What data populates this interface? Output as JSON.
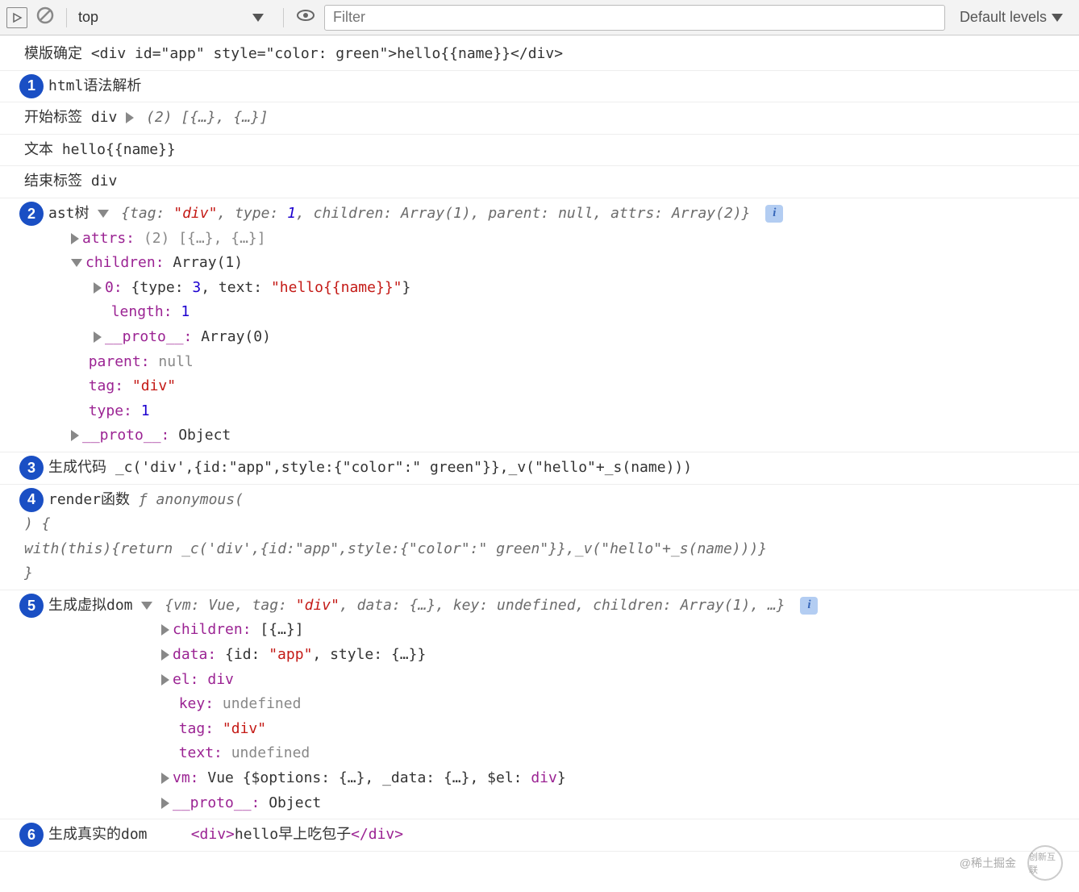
{
  "toolbar": {
    "context": "top",
    "filter_placeholder": "Filter",
    "levels": "Default levels"
  },
  "lines": {
    "l0_label": "模版确定",
    "l0_code": "<div id=\"app\" style=\"color: green\">hello{{name}}</div>",
    "b1": "1",
    "l1": "html语法解析",
    "l2_label": "开始标签 div",
    "l2_preview": "(2) [{…}, {…}]",
    "l3": "文本 hello{{name}}",
    "l4": "结束标签 div",
    "b2": "2",
    "l5_label": "ast树",
    "ast_summary_pre": "{tag: ",
    "ast_tag_val": "\"div\"",
    "ast_summary_mid1": ", type: ",
    "ast_type_val": "1",
    "ast_summary_mid2": ", children: Array(1), parent: null, attrs: Array(2)}",
    "ast_attrs_k": "attrs:",
    "ast_attrs_v": "(2) [{…}, {…}]",
    "ast_children_k": "children:",
    "ast_children_v": "Array(1)",
    "ast_c0_k": "0:",
    "ast_c0_pre": "{type: ",
    "ast_c0_type": "3",
    "ast_c0_mid": ", text: ",
    "ast_c0_text": "\"hello{{name}}\"",
    "ast_c0_post": "}",
    "ast_len_k": "length:",
    "ast_len_v": "1",
    "ast_cproto_k": "__proto__:",
    "ast_cproto_v": "Array(0)",
    "ast_parent_k": "parent:",
    "ast_parent_v": "null",
    "ast_tag_k": "tag:",
    "ast_tag_v2": "\"div\"",
    "ast_type_k": "type:",
    "ast_type_v2": "1",
    "ast_proto_k": "__proto__:",
    "ast_proto_v": "Object",
    "b3": "3",
    "l_gen_label": "生成代码",
    "l_gen_code": "_c('div',{id:\"app\",style:{\"color\":\" green\"}},_v(\"hello\"+_s(name)))",
    "b4": "4",
    "l_render_label": "render函数",
    "l_render_fn": "ƒ anonymous(",
    "l_render_body": ") {\nwith(this){return _c('div',{id:\"app\",style:{\"color\":\" green\"}},_v(\"hello\"+_s(name)))}\n}",
    "b5": "5",
    "l_vdom_label": "生成虚拟dom",
    "vdom_summary": "{vm: Vue, tag: ",
    "vdom_tag": "\"div\"",
    "vdom_summary2": ", data: {…}, key: undefined, children: Array(1), …}",
    "vdom_children_k": "children:",
    "vdom_children_v": "[{…}]",
    "vdom_data_k": "data:",
    "vdom_data_pre": "{id: ",
    "vdom_data_id": "\"app\"",
    "vdom_data_post": ", style: {…}}",
    "vdom_el_k": "el:",
    "vdom_el_v": "div",
    "vdom_key_k": "key:",
    "vdom_key_v": "undefined",
    "vdom_tagk": "tag:",
    "vdom_tagv": "\"div\"",
    "vdom_text_k": "text:",
    "vdom_text_v": "undefined",
    "vdom_vm_k": "vm:",
    "vdom_vm_v1": "Vue {$options: {…}, _data: {…}, $el: ",
    "vdom_vm_el": "div",
    "vdom_vm_v2": "}",
    "vdom_proto_k": "__proto__:",
    "vdom_proto_v": "Object",
    "b6": "6",
    "l_real_label": "生成真实的dom",
    "l_real_tag1": "<div>",
    "l_real_text": "hello早上吃包子",
    "l_real_tag2": "</div>"
  },
  "watermark": {
    "text": "@稀土掘金",
    "brand": "创新互联"
  }
}
